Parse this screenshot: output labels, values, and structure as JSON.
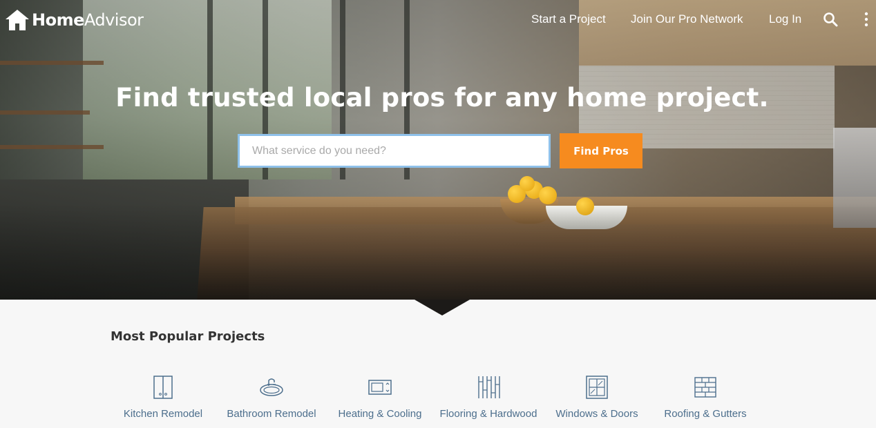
{
  "brand": {
    "name_bold": "Home",
    "name_light": "Advisor",
    "logo_icon": "house-icon"
  },
  "nav": {
    "links": [
      "Start a Project",
      "Join Our Pro Network",
      "Log In"
    ],
    "search_icon": "search-icon",
    "menu_icon": "more-vertical-icon"
  },
  "hero": {
    "headline": "Find trusted local pros for any home project.",
    "search_placeholder": "What service do you need?",
    "search_value": "",
    "cta_label": "Find Pros"
  },
  "popular": {
    "title": "Most Popular Projects",
    "items": [
      {
        "label": "Kitchen Remodel",
        "icon": "kitchen-icon"
      },
      {
        "label": "Bathroom Remodel",
        "icon": "bathroom-icon"
      },
      {
        "label": "Heating & Cooling",
        "icon": "heating-icon"
      },
      {
        "label": "Flooring & Hardwood",
        "icon": "flooring-icon"
      },
      {
        "label": "Windows & Doors",
        "icon": "windows-icon"
      },
      {
        "label": "Roofing & Gutters",
        "icon": "roofing-icon"
      }
    ]
  },
  "colors": {
    "accent": "#f68b1f",
    "link": "#4c6e8c",
    "input_border": "#8fc1ea"
  }
}
